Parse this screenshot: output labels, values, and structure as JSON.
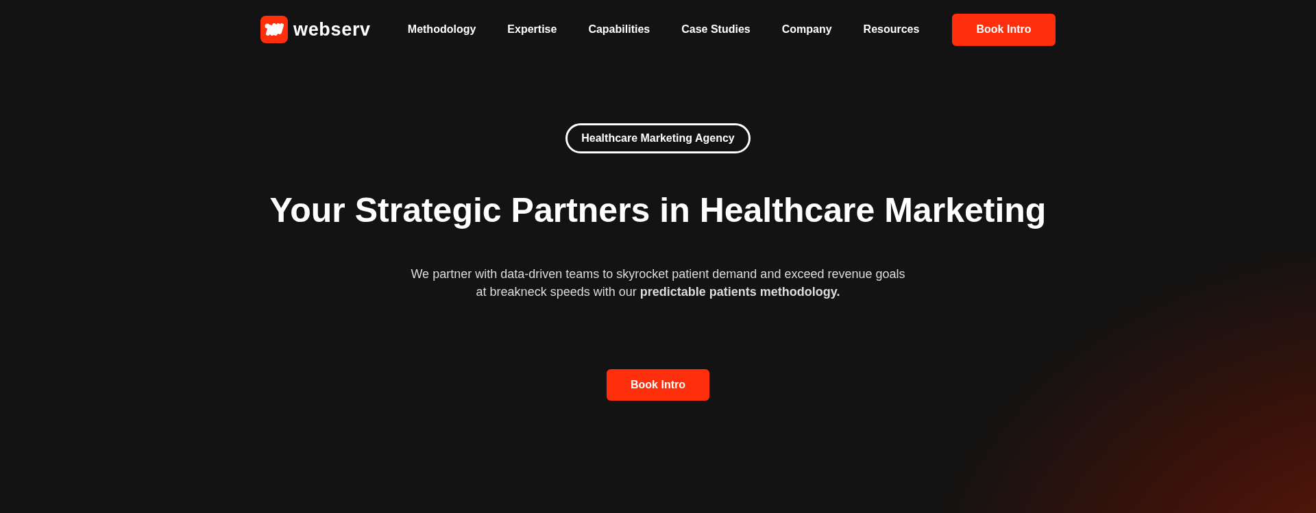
{
  "logo": {
    "text": "webserv"
  },
  "nav": [
    {
      "label": "Methodology"
    },
    {
      "label": "Expertise"
    },
    {
      "label": "Capabilities"
    },
    {
      "label": "Case Studies"
    },
    {
      "label": "Company"
    },
    {
      "label": "Resources"
    }
  ],
  "nav_button": "Book Intro",
  "hero": {
    "badge": "Healthcare Marketing Agency",
    "title": "Your Strategic Partners in Healthcare Marketing",
    "text": "We partner with data-driven teams to skyrocket patient demand and exceed revenue goals at breakneck speeds with our **predictable patients methodology.**",
    "button": "Book Intro"
  }
}
